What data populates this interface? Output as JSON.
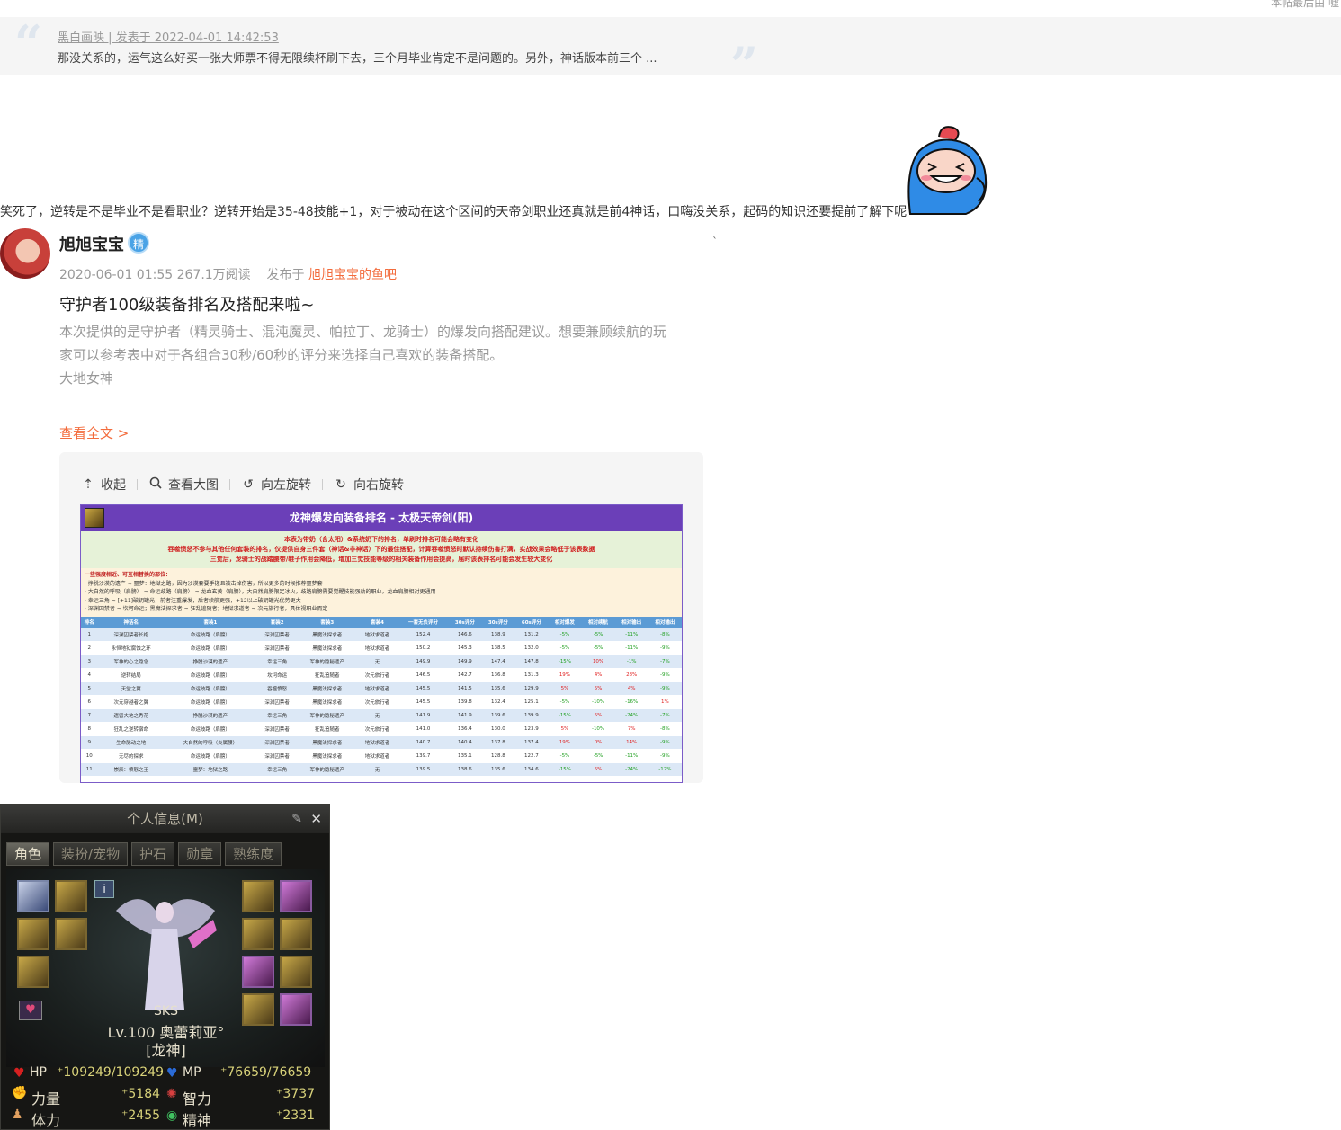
{
  "top_note": "本帖最后由 嘘",
  "quote": {
    "meta": "黑白画映 | 发表于 2022-04-01 14:42:53",
    "text": "那没关系的，运气这么好买一张大师票不得无限续杯刷下去，三个月毕业肯定不是问题的。另外，神话版本前三个 ..."
  },
  "reply": "笑死了，逆转是不是毕业不是看职业？逆转开始是35-48技能+1，对于被动在这个区间的天帝剑职业还真就是前4神话，口嗨没关系，起码的知识还要提前了解下呢",
  "tick_mark": "`",
  "post": {
    "author": "旭旭宝宝",
    "badge": "精",
    "date_reads": "2020-06-01 01:55  267.1万阅读",
    "posted_in_prefix": "发布于",
    "forum": "旭旭宝宝的鱼吧",
    "title": "守护者100级装备排名及搭配来啦~",
    "body_line1": "本次提供的是守护者（精灵骑士、混沌魔灵、帕拉丁、龙骑士）的爆发向搭配建议。想要兼顾续航的玩",
    "body_line2": "家可以参考表中对于各组合30秒/60秒的评分来选择自己喜欢的装备搭配。",
    "body_line3": "大地女神",
    "read_more": "查看全文 >"
  },
  "viewer": {
    "collapse": "收起",
    "view_large": "查看大图",
    "rotate_left": "向左旋转",
    "rotate_right": "向右旋转"
  },
  "sheet": {
    "title": "龙神爆发向装备排名 - 太极天帝剑(阳)",
    "note1": "本表为带奶（含太阳）&系统奶下的排名，单刷时排名可能会略有变化",
    "note2": "吞噬愤怒不参与其他任何套装的排名，仅提供自身三件套（神话&非神话）下的最佳搭配，计算吞噬愤怒时默认持续伤害打满，实战效果会略低于该表数据",
    "note3": "三觉后，龙骑士的战踏腰带/鞋子作用会降低，增加三觉技能等级的相关装备作用会提高，届时该表排名可能会发生较大变化",
    "list_head": "一些强度相近、可互相替换的部位：",
    "list": [
      "· 挣脱沙漠的遗产 ≈ 噩梦：地狱之路，因为沙漠套要手搓且被击掉伤害，所以更多的时候推荐噩梦套",
      "· 大自然的呼吸（肩膀） ≈ 命运歧路（肩膀） ≈ 龙血玄黄（肩膀），大自然肩膀限定冰火，歧路肩膀需要觉醒技能强劲的职业，龙血肩膀相对更通用",
      "· 幸运三角 ≈ [+11]破钥罐光，前者注重爆发，后者续航更强，+12以上破钥罐光优势更大",
      "· 深渊囚禁者 ≈ 坎坷命运；黑魔法探求者 ≈ 狂乱追随者；地狱求道者 ≈ 次元旅行者，具体视职业而定"
    ],
    "headers": [
      "排名",
      "神话名",
      "套装1",
      "套装2",
      "套装3",
      "套装4",
      "一套无负评分",
      "30s评分",
      "30s评分",
      "60s评分",
      "相对爆发",
      "相对续航",
      "相对输出",
      "相对输出"
    ],
    "rows": [
      [
        "1",
        "深渊囚禁者长袍",
        "命运歧路（肩膀）",
        "深渊囚禁者",
        "黑魔法探求者",
        "地狱求道者",
        "152.4",
        "146.6",
        "138.9",
        "131.2",
        "-5%",
        "-5%",
        "-11%",
        "-8%"
      ],
      [
        "2",
        "永恒地狱腐蚀之环",
        "命运歧路（肩膀）",
        "深渊囚禁者",
        "黑魔法探求者",
        "地狱求道者",
        "150.2",
        "145.3",
        "138.5",
        "132.0",
        "-5%",
        "-5%",
        "-11%",
        "-9%"
      ],
      [
        "3",
        "军神的心之隐念",
        "挣脱沙漠的遗产",
        "幸运三角",
        "军神的隐秘遗产",
        "无",
        "149.9",
        "149.9",
        "147.4",
        "147.8",
        "-15%",
        "10%",
        "-1%",
        "-7%"
      ],
      [
        "4",
        "逆转结局",
        "命运歧路（肩膀）",
        "坎坷命运",
        "狂乱追随者",
        "次元旅行者",
        "146.5",
        "142.7",
        "136.8",
        "131.3",
        "19%",
        "4%",
        "28%",
        "-9%"
      ],
      [
        "5",
        "天堂之翼",
        "命运歧路（肩膀）",
        "吞噬愤怒",
        "黑魔法探求者",
        "地狱求道者",
        "145.5",
        "141.5",
        "135.6",
        "129.9",
        "5%",
        "5%",
        "4%",
        "-9%"
      ],
      [
        "6",
        "次元穿越者之翼",
        "命运歧路（肩膀）",
        "深渊囚禁者",
        "黑魔法探求者",
        "次元旅行者",
        "145.5",
        "139.8",
        "132.4",
        "125.1",
        "-5%",
        "-10%",
        "-16%",
        "1%"
      ],
      [
        "7",
        "遗留大地之秀花",
        "挣脱沙漠的遗产",
        "幸运三角",
        "军神的隐秘遗产",
        "无",
        "141.9",
        "141.9",
        "139.6",
        "139.9",
        "-15%",
        "5%",
        "-24%",
        "-7%"
      ],
      [
        "8",
        "狂乱之逆转宿命",
        "命运歧路（肩膀）",
        "深渊囚禁者",
        "狂乱追随者",
        "次元旅行者",
        "141.0",
        "136.4",
        "130.0",
        "123.9",
        "5%",
        "-10%",
        "7%",
        "-8%"
      ],
      [
        "9",
        "生命脉动之地",
        "大自然的呼吸（炎属腰）",
        "深渊囚禁者",
        "黑魔法探求者",
        "地狱求道者",
        "140.7",
        "140.4",
        "137.8",
        "137.4",
        "19%",
        "0%",
        "14%",
        "-9%"
      ],
      [
        "10",
        "无尽的探求",
        "命运歧路（肩膀）",
        "深渊囚禁者",
        "黑魔法探求者",
        "地狱求道者",
        "139.7",
        "135.1",
        "128.8",
        "122.7",
        "-5%",
        "-5%",
        "-11%",
        "-9%"
      ],
      [
        "11",
        "崇辰：愤怒之王",
        "噩梦：地狱之路",
        "幸运三角",
        "军神的隐秘遗产",
        "无",
        "139.5",
        "138.6",
        "135.6",
        "134.6",
        "-15%",
        "5%",
        "-24%",
        "-12%"
      ]
    ]
  },
  "game": {
    "title": "个人信息(M)",
    "tabs": [
      "角色",
      "装扮/宠物",
      "护石",
      "勋章",
      "熟练度"
    ],
    "info": "i",
    "guild": "SKS",
    "name": "Lv.100 奥蕾莉亚°",
    "title_tag": "[龙神]",
    "hp_label": "HP",
    "hp_value": "109249/109249",
    "mp_label": "MP",
    "mp_value": "76659/76659",
    "str_label": "力量",
    "str_value": "5184",
    "int_label": "智力",
    "int_value": "3737",
    "vit_label": "体力",
    "vit_value": "2455",
    "spr_label": "精神",
    "spr_value": "2331",
    "colors": {
      "hp": "#d62020",
      "mp": "#2a6ad6",
      "stat": "#d8d27a"
    }
  }
}
